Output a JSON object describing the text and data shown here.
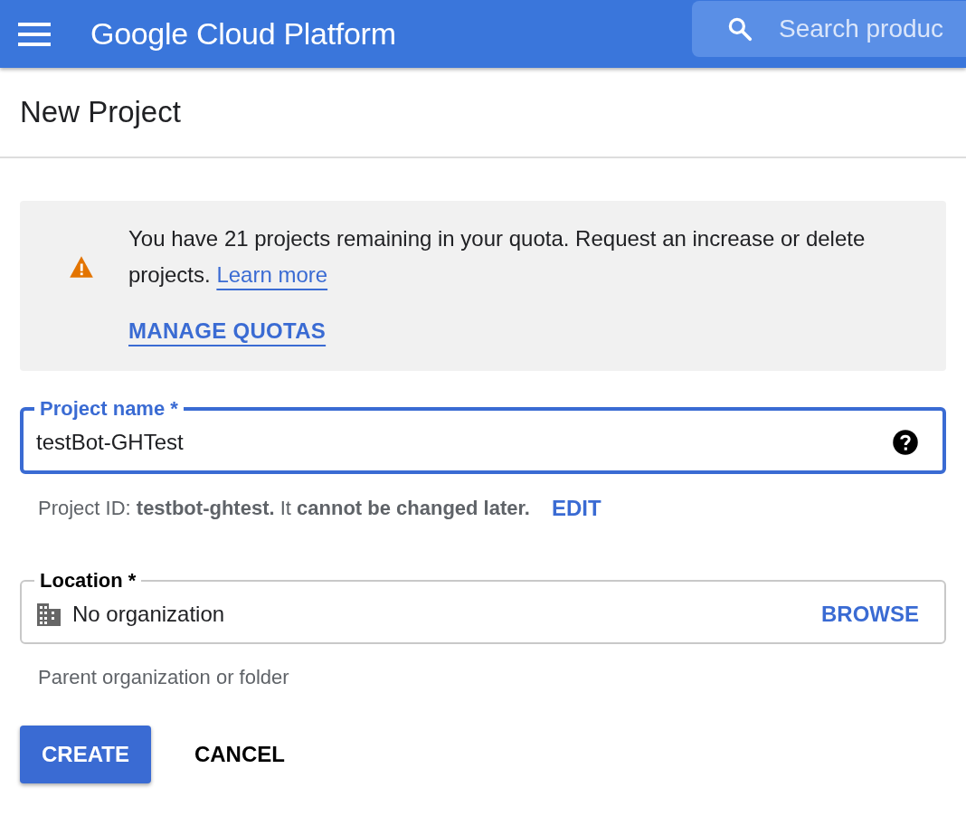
{
  "top_bar": {
    "title": "Google Cloud Platform",
    "search": {
      "placeholder": "Search produc"
    }
  },
  "page": {
    "title": "New Project"
  },
  "notice": {
    "text": "You have 21 projects remaining in your quota. Request an increase or delete projects.",
    "link": "Learn more",
    "action": "MANAGE QUOTAS"
  },
  "project_name": {
    "label": "Project name *",
    "value": "testBot-GHTest",
    "focused": true
  },
  "project_id": {
    "text": "Project ID: **testbot-ghtest.** It **cannot be changed later.**",
    "action": "EDIT"
  },
  "location": {
    "label": "Location *",
    "value": "No organization",
    "action": "BROWSE",
    "hint": "Parent organization or folder"
  },
  "buttons": [
    {
      "label": "CREATE",
      "kind": "primary"
    },
    {
      "label": "CANCEL",
      "kind": "text"
    }
  ]
}
